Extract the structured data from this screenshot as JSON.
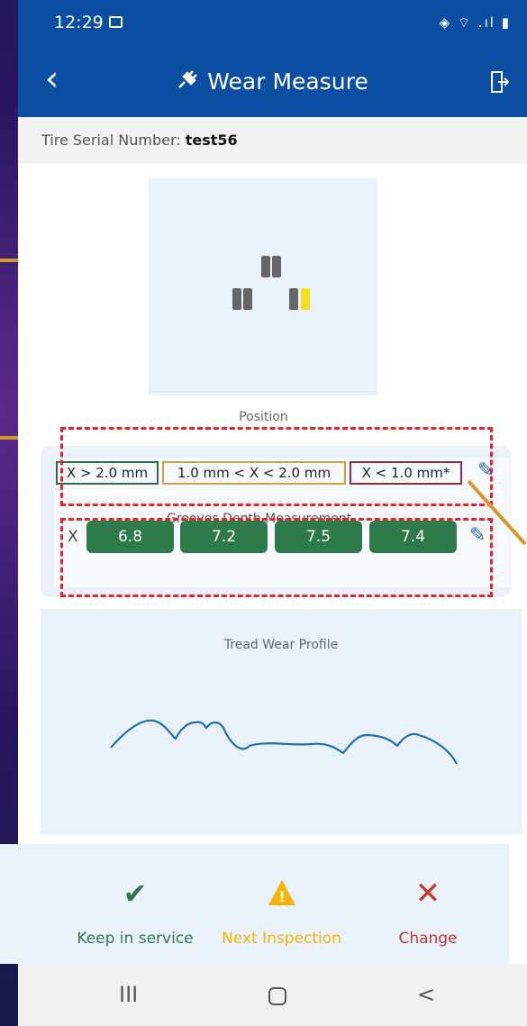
{
  "status": {
    "time": "12:29",
    "icons": "◈ ⌔ .ıl ▮"
  },
  "appbar": {
    "title": "Wear Measure",
    "back_icon": "chevron-left-icon",
    "exit_icon": "exit-door-icon"
  },
  "serial": {
    "label": "Tire Serial Number: ",
    "value": "test56"
  },
  "position_label": "Position",
  "legend": {
    "good": "X > 2.0 mm",
    "medium": "1.0 mm < X < 2.0 mm",
    "bad": "X < 1.0 mm*"
  },
  "grooves": {
    "label": "Grooves Depth Measurement",
    "axis": "X",
    "values": [
      "6.8",
      "7.2",
      "7.5",
      "7.4"
    ]
  },
  "tread": {
    "title": "Tread Wear Profile"
  },
  "actions": {
    "keep": "Keep in service",
    "next": "Next Inspection",
    "change": "Change"
  },
  "colors": {
    "brand": "#0b4ea2",
    "good": "#2e7a4a",
    "warning": "#f4b400",
    "danger": "#c0392b",
    "annotation": "#e8232b"
  },
  "nav": {
    "recents": "III",
    "back": "<"
  }
}
